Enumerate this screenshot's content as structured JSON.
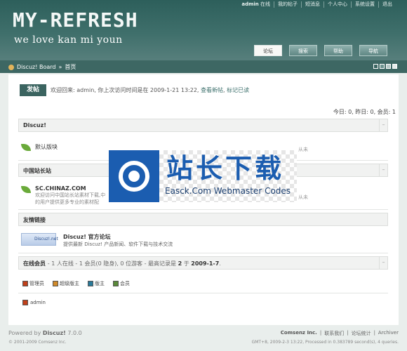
{
  "topnav": {
    "user": "admin",
    "status": "在线",
    "my_posts": "我的帖子",
    "short_msg": "短消息",
    "usercenter": "个人中心",
    "settings": "系统设置",
    "logout": "退出"
  },
  "logo": {
    "title": "MY-REFRESH",
    "tagline": "we love kan mi youn"
  },
  "mainnav": {
    "forum": "论坛",
    "search": "搜索",
    "help": "帮助",
    "guide": "导航"
  },
  "breadcrumb": {
    "board": "Discuz! Board",
    "separator": "»",
    "home": "首页"
  },
  "welcome": {
    "post_button": "发帖",
    "text": "欢迎回来: admin, 你上次访问时间是在 2009-1-21 13:22,",
    "view_new": "查看新帖",
    "mark_read": "标记已读"
  },
  "stats": {
    "line": "今日: 0, 昨日: 0, 会员: 1"
  },
  "categories": [
    {
      "name": "Discuz!",
      "forums": [
        {
          "name": "默认版块",
          "desc": ""
        }
      ]
    },
    {
      "name": "中国站长站",
      "forums": [
        {
          "name": "SC.CHINAZ.COM",
          "desc1": "欢迎访问中国站长站素材下载,中",
          "desc2": "的用户提供更多专业的素材配"
        }
      ]
    }
  ],
  "side_notes": {
    "n1": "从未",
    "n2": "从未"
  },
  "links": {
    "heading": "友情链接",
    "partner_name": "Discuz! 官方论坛",
    "partner_desc": "提供最新 Discuz! 产品新闻、软件下载与技术交流",
    "partner_logo_text": "Discuz!.net"
  },
  "online": {
    "heading": "在线会员",
    "text_prefix": "- 1 人在线 - 1 会员(0 隐身), 0 位游客 - 最高记录是 ",
    "record": "2",
    "text_suffix": " 于 ",
    "record_date": "2009-1-7",
    "end": "."
  },
  "legend": [
    {
      "label": "管理员",
      "color": "#c0401a",
      "icon": "admin-icon"
    },
    {
      "label": "超级版主",
      "color": "#d08a2a",
      "icon": "supermod-icon"
    },
    {
      "label": "版主",
      "color": "#2a7a9a",
      "icon": "mod-icon"
    },
    {
      "label": "会员",
      "color": "#5a8a3a",
      "icon": "member-icon"
    }
  ],
  "online_user": "admin",
  "footer": {
    "powered_prefix": "Powered by ",
    "powered_name": "Discuz!",
    "version": " 7.0.0",
    "copyright": "© 2001-2009 Comsenz Inc.",
    "company": "Comsenz Inc.",
    "contact": "联系我们",
    "stats": "论坛统计",
    "archiver": "Archiver",
    "gmt": "GMT+8, 2009-2-3 13:22, Processed in 0.383789 second(s), 4 queries."
  },
  "watermark": {
    "title": "站长下载",
    "subtitle": "Easck.Com Webmaster Codes"
  },
  "colors": {
    "header": "#2d5f5b",
    "accent": "#3b6460"
  }
}
